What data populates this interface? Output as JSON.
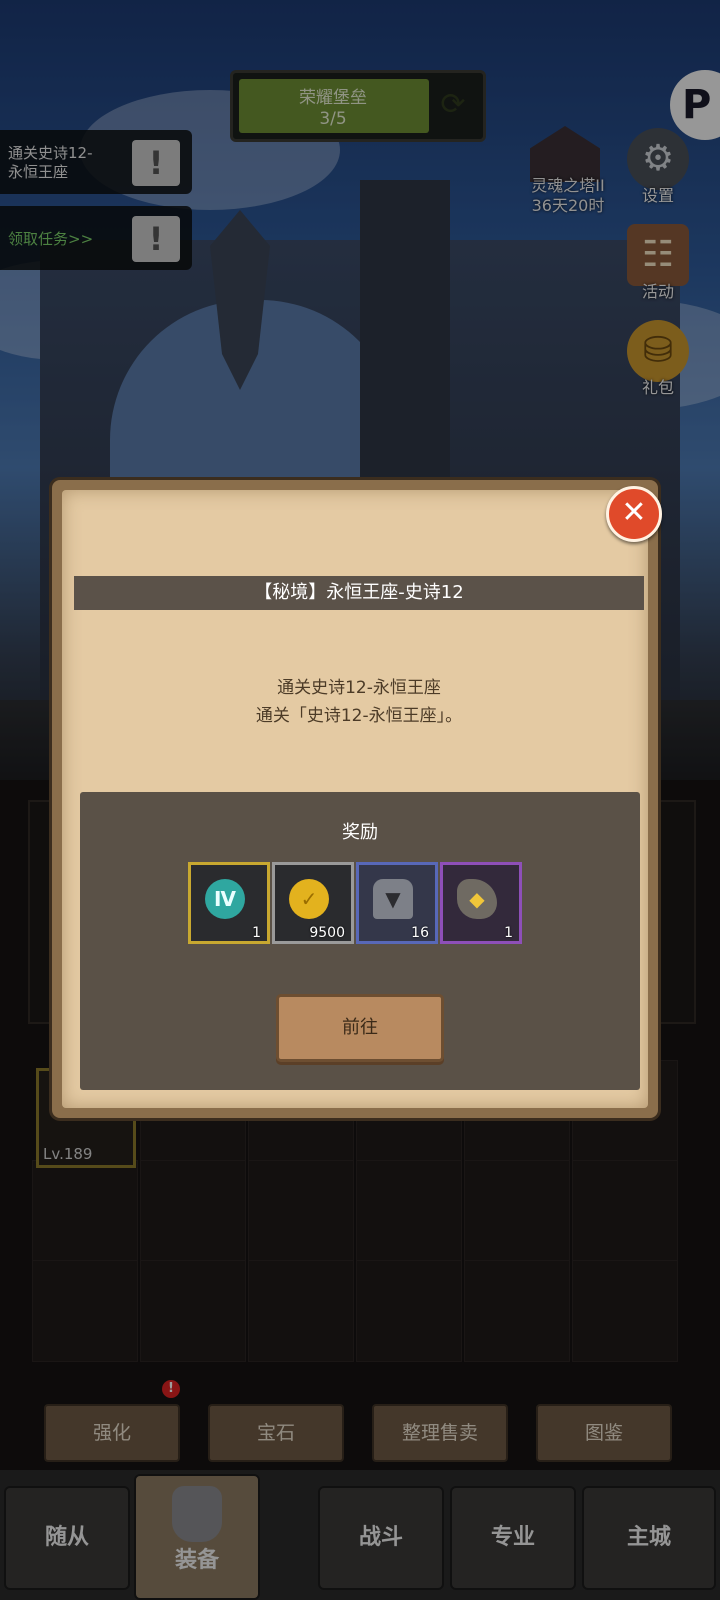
{
  "hud": {
    "quest_title": "荣耀堡垒",
    "quest_progress": "3/5",
    "tasks": [
      {
        "text_line1": "通关史诗12-",
        "text_line2": "永恒王座"
      },
      {
        "text_line1": "领取任务>>",
        "text_line2": ""
      }
    ],
    "tower_label_line1": "灵魂之塔II",
    "tower_label_line2": "36天20时",
    "side_buttons": [
      {
        "label": "设置",
        "icon": "gear-icon"
      },
      {
        "label": "活动",
        "icon": "scroll-icon"
      },
      {
        "label": "礼包",
        "icon": "gift-icon"
      }
    ]
  },
  "dialog": {
    "title": "【秘境】永恒王座-史诗12",
    "desc_line1": "通关史诗12-永恒王座",
    "desc_line2": "通关「史诗12-永恒王座」。",
    "reward_title": "奖励",
    "rewards": [
      {
        "count": "1",
        "icon": "rune-iv-icon",
        "rarity_color": "#c8a830"
      },
      {
        "count": "9500",
        "icon": "gold-coin-icon",
        "rarity_color": "#9a9a9a"
      },
      {
        "count": "16",
        "icon": "helmet-icon",
        "rarity_color": "#5868b8"
      },
      {
        "count": "1",
        "icon": "ore-icon",
        "rarity_color": "#8e4fb8"
      }
    ],
    "goto_label": "前往"
  },
  "equipment": {
    "level_label": "Lv.189"
  },
  "actions": {
    "enhance": "强化",
    "gem": "宝石",
    "sort_sell": "整理售卖",
    "codex": "图鉴"
  },
  "nav": {
    "followers": "随从",
    "equipment": "装备",
    "battle": "战斗",
    "profession": "专业",
    "main_city": "主城"
  }
}
